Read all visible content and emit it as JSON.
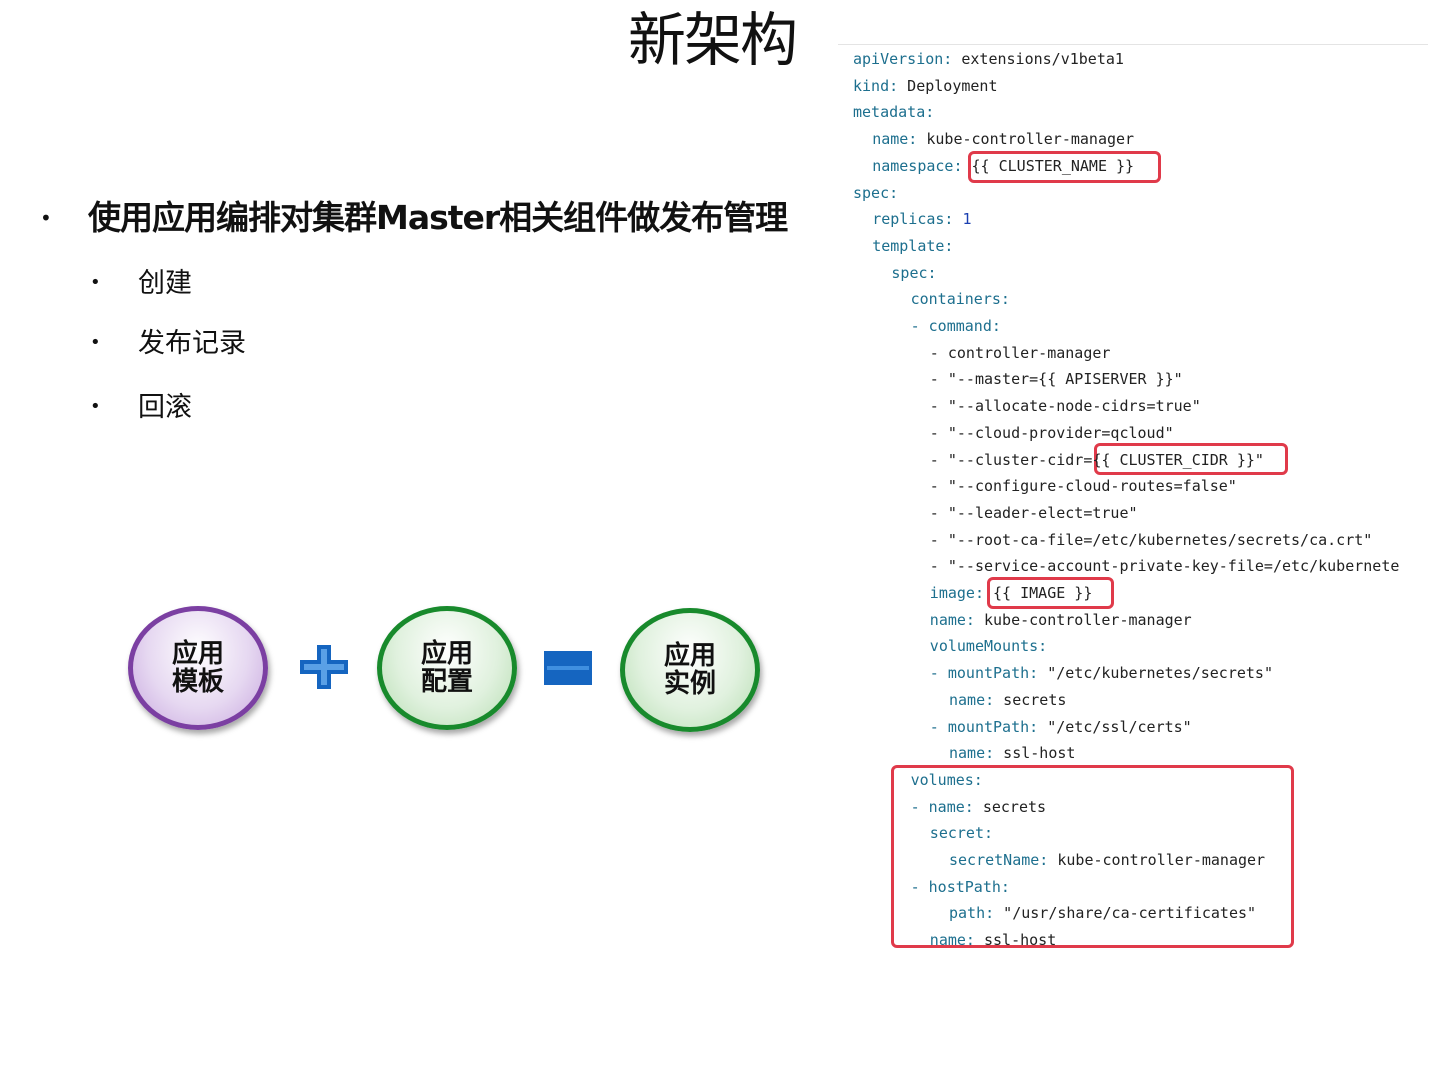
{
  "slide": {
    "title": "新架构",
    "main_bullet": "使用应用编排对集群Master相关组件做发布管理",
    "sub_bullets": [
      "创建",
      "发布记录",
      "回滚"
    ],
    "bullet_char": "•"
  },
  "formula": {
    "template": {
      "line1": "应用",
      "line2": "模板"
    },
    "config": {
      "line1": "应用",
      "line2": "配置"
    },
    "instance": {
      "line1": "应用",
      "line2": "实例"
    },
    "colors": {
      "purple": "#7b3fa2",
      "green": "#188a2c",
      "blue": "#1565c0"
    }
  },
  "code": {
    "lines": [
      {
        "indent": 0,
        "key": "apiVersion:",
        "value": " extensions/v1beta1"
      },
      {
        "indent": 0,
        "key": "kind:",
        "value": " Deployment"
      },
      {
        "indent": 0,
        "key": "metadata:",
        "value": ""
      },
      {
        "indent": 1,
        "key": "name:",
        "value": " kube-controller-manager"
      },
      {
        "indent": 1,
        "key": "namespace:",
        "value": " {{ CLUSTER_NAME }}"
      },
      {
        "indent": 0,
        "key": "spec:",
        "value": ""
      },
      {
        "indent": 1,
        "key": "replicas:",
        "value": " 1",
        "numeric": true
      },
      {
        "indent": 1,
        "key": "template:",
        "value": ""
      },
      {
        "indent": 2,
        "key": "spec:",
        "value": ""
      },
      {
        "indent": 3,
        "key": "containers:",
        "value": ""
      },
      {
        "indent": 3,
        "key": "- command:",
        "value": ""
      },
      {
        "indent": 4,
        "key": "",
        "value": "- controller-manager"
      },
      {
        "indent": 4,
        "key": "",
        "value": "- \"--master={{ APISERVER }}\""
      },
      {
        "indent": 4,
        "key": "",
        "value": "- \"--allocate-node-cidrs=true\""
      },
      {
        "indent": 4,
        "key": "",
        "value": "- \"--cloud-provider=qcloud\""
      },
      {
        "indent": 4,
        "key": "",
        "value": "- \"--cluster-cidr={{ CLUSTER_CIDR }}\""
      },
      {
        "indent": 4,
        "key": "",
        "value": "- \"--configure-cloud-routes=false\""
      },
      {
        "indent": 4,
        "key": "",
        "value": "- \"--leader-elect=true\""
      },
      {
        "indent": 4,
        "key": "",
        "value": "- \"--root-ca-file=/etc/kubernetes/secrets/ca.crt\""
      },
      {
        "indent": 4,
        "key": "",
        "value": "- \"--service-account-private-key-file=/etc/kubernete"
      },
      {
        "indent": 4,
        "key": "image:",
        "value": " {{ IMAGE }}"
      },
      {
        "indent": 4,
        "key": "name:",
        "value": " kube-controller-manager"
      },
      {
        "indent": 4,
        "key": "volumeMounts:",
        "value": ""
      },
      {
        "indent": 4,
        "key": "- mountPath:",
        "value": " \"/etc/kubernetes/secrets\""
      },
      {
        "indent": 5,
        "key": "name:",
        "value": " secrets"
      },
      {
        "indent": 4,
        "key": "- mountPath:",
        "value": " \"/etc/ssl/certs\""
      },
      {
        "indent": 5,
        "key": "name:",
        "value": " ssl-host"
      },
      {
        "indent": 3,
        "key": "volumes:",
        "value": ""
      },
      {
        "indent": 3,
        "key": "- name:",
        "value": " secrets"
      },
      {
        "indent": 4,
        "key": "secret:",
        "value": ""
      },
      {
        "indent": 5,
        "key": "secretName:",
        "value": " kube-controller-manager"
      },
      {
        "indent": 3,
        "key": "- hostPath:",
        "value": ""
      },
      {
        "indent": 5,
        "key": "path:",
        "value": " \"/usr/share/ca-certificates\""
      },
      {
        "indent": 4,
        "key": "name:",
        "value": " ssl-host"
      }
    ],
    "highlight_color": "#e03a4a"
  }
}
